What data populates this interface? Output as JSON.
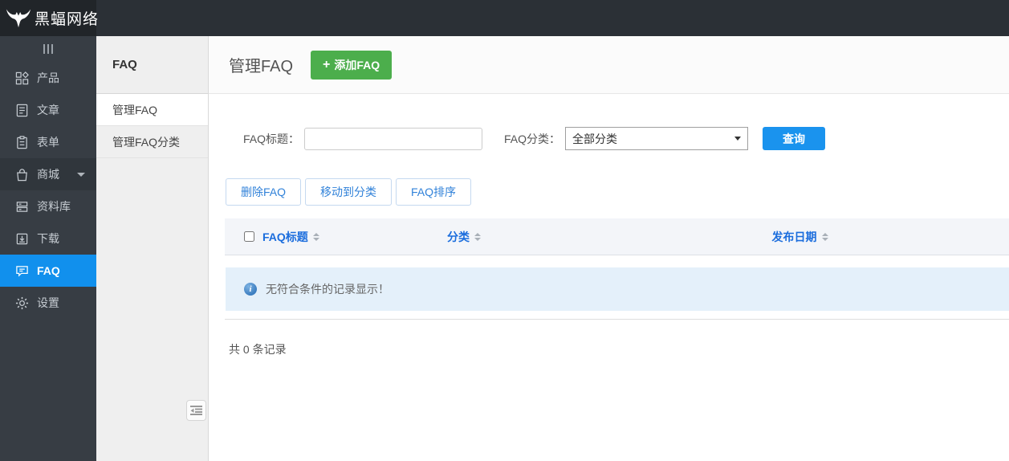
{
  "topbar": {
    "logo_text": "黑蝠网络",
    "logo_icon": "bat-icon"
  },
  "sidebar": {
    "toggle_icon": "collapse-bars-icon",
    "items": [
      {
        "label": "产品",
        "icon": "products-grid-icon",
        "active": false
      },
      {
        "label": "文章",
        "icon": "article-icon",
        "active": false
      },
      {
        "label": "表单",
        "icon": "form-clipboard-icon",
        "active": false
      },
      {
        "label": "商城",
        "icon": "mall-bag-icon",
        "active": false,
        "has_submenu": true
      },
      {
        "label": "资料库",
        "icon": "library-icon",
        "active": false
      },
      {
        "label": "下载",
        "icon": "download-icon",
        "active": false
      },
      {
        "label": "FAQ",
        "icon": "faq-bubble-icon",
        "active": true
      },
      {
        "label": "设置",
        "icon": "settings-gear-icon",
        "active": false
      }
    ]
  },
  "subsidebar": {
    "title": "FAQ",
    "items": [
      {
        "label": "管理FAQ",
        "active": true
      },
      {
        "label": "管理FAQ分类",
        "active": false
      }
    ],
    "collapse_icon": "indent-collapse-icon"
  },
  "main": {
    "page_title": "管理FAQ",
    "add_button": {
      "plus": "+",
      "label": "添加FAQ"
    },
    "filter": {
      "title_label": "FAQ标题：",
      "title_value": "",
      "category_label": "FAQ分类：",
      "category_selected": "全部分类",
      "search_button": "查询"
    },
    "toolbar": {
      "delete": "删除FAQ",
      "move": "移动到分类",
      "sort": "FAQ排序"
    },
    "table": {
      "columns": [
        "FAQ标题",
        "分类",
        "发布日期"
      ]
    },
    "empty_message": "无符合条件的记录显示！",
    "record_count": "共 0 条记录"
  },
  "colors": {
    "topbar_dark": "#2b3036",
    "sidebar_dark": "#373d44",
    "active_blue": "#1190ed",
    "search_blue": "#1a93ee",
    "success_green": "#4cae4c",
    "table_header_blue": "#1b6ddd",
    "alert_bg": "#e4f0fa"
  }
}
